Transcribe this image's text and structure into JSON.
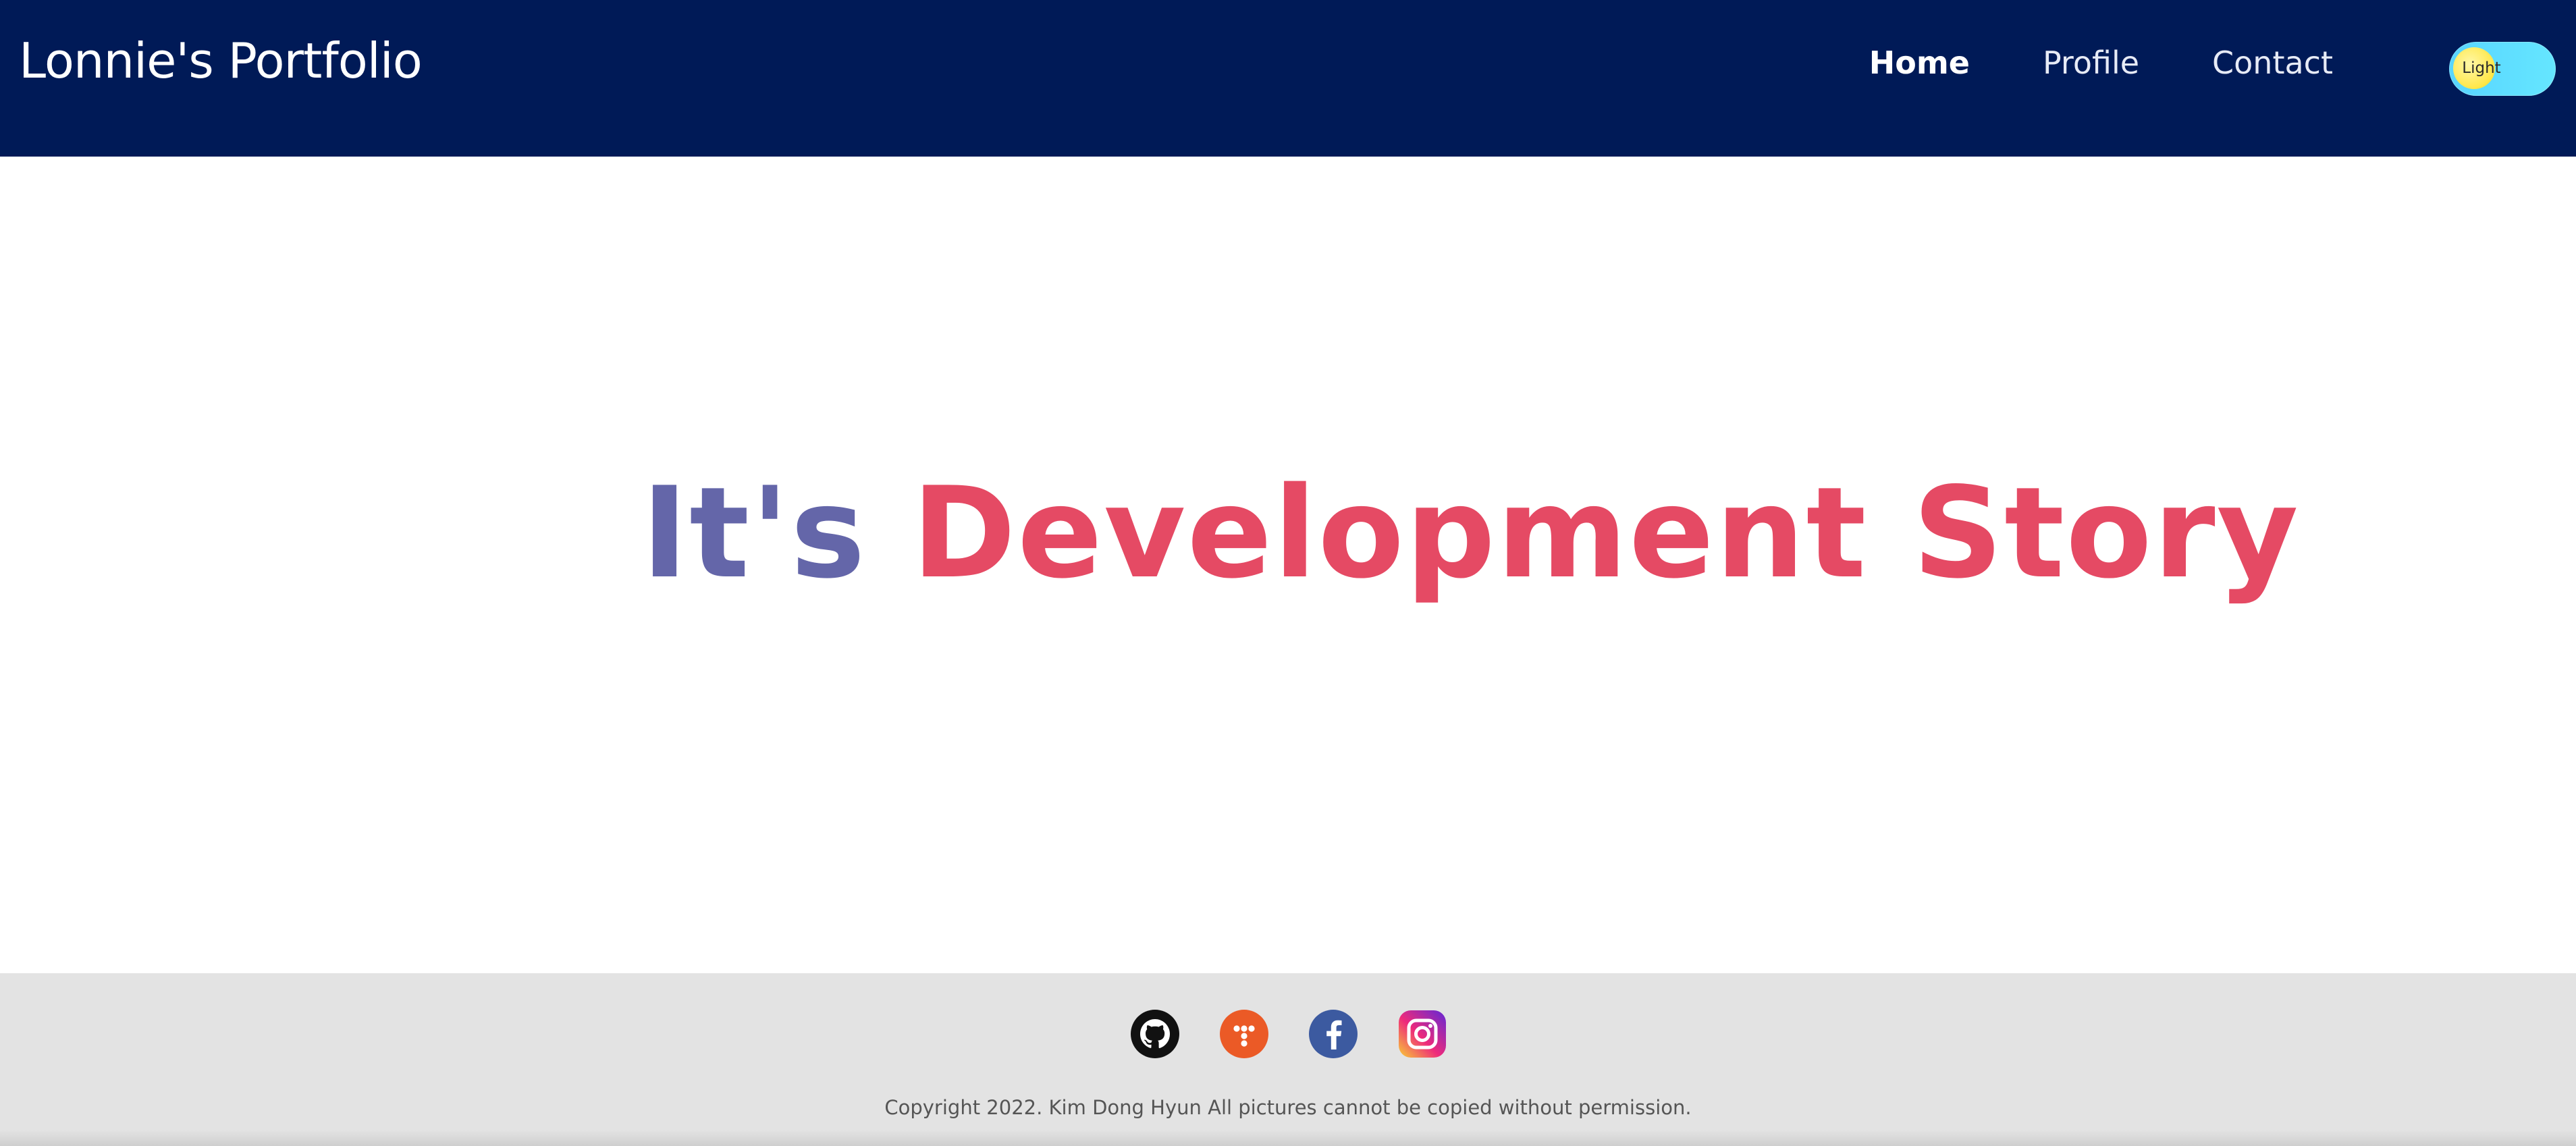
{
  "header": {
    "title": "Lonnie's Portfolio",
    "nav": [
      {
        "label": "Home",
        "active": true
      },
      {
        "label": "Profile",
        "active": false
      },
      {
        "label": "Contact",
        "active": false
      }
    ],
    "theme_toggle_label": "Light"
  },
  "hero": {
    "prefix": "It's",
    "title": "Development Story"
  },
  "footer": {
    "social_icons": [
      "github-icon",
      "todoist-icon",
      "facebook-icon",
      "instagram-icon"
    ],
    "copyright": "Copyright 2022. Kim Dong Hyun All pictures cannot be copied without permission."
  },
  "colors": {
    "header_bg": "#001a57",
    "accent_purple": "#6466a9",
    "accent_red": "#e54a64",
    "footer_bg": "#e3e3e3",
    "toggle_bg": "#58d5ff",
    "toggle_knob": "#ffe74a"
  }
}
